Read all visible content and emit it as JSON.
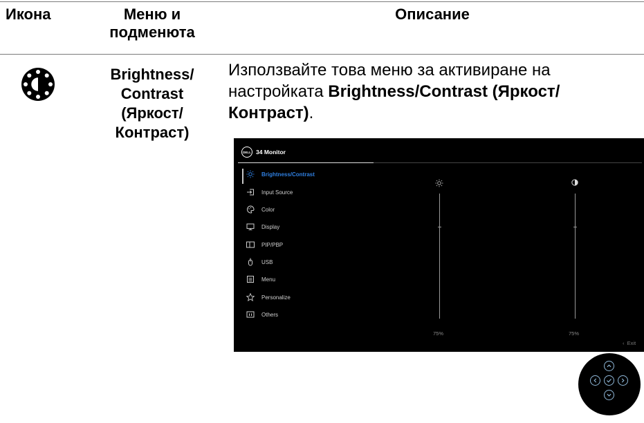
{
  "table": {
    "headers": {
      "icon": "Икона",
      "menu_line1": "Меню и",
      "menu_line2": "подменюта",
      "description": "Описание"
    },
    "row": {
      "icon": "brightness-contrast-icon",
      "menu_lines": [
        "Brightness/",
        "Contrast",
        "(Яркост/",
        "Контраст)"
      ],
      "desc_prefix": "Използвайте това меню за активиране на настройката ",
      "desc_bold": "Brightness/Contrast (Яркост/ Контраст)",
      "desc_suffix": "."
    }
  },
  "osd": {
    "logo_text": "DELL",
    "title": "34 Monitor",
    "menu_items": [
      {
        "label": "Brightness/Contrast",
        "icon": "sun-icon",
        "active": true
      },
      {
        "label": "Input Source",
        "icon": "input-source-icon",
        "active": false
      },
      {
        "label": "Color",
        "icon": "color-palette-icon",
        "active": false
      },
      {
        "label": "Display",
        "icon": "display-icon",
        "active": false
      },
      {
        "label": "PIP/PBP",
        "icon": "pip-pbp-icon",
        "active": false
      },
      {
        "label": "USB",
        "icon": "usb-icon",
        "active": false
      },
      {
        "label": "Menu",
        "icon": "menu-icon",
        "active": false
      },
      {
        "label": "Personalize",
        "icon": "star-icon",
        "active": false
      },
      {
        "label": "Others",
        "icon": "others-icon",
        "active": false
      }
    ],
    "brightness": {
      "icon": "sun-icon",
      "value_label": "75%",
      "level": 0.75
    },
    "contrast": {
      "icon": "contrast-icon",
      "value_label": "75%",
      "level": 0.75
    },
    "exit_label": "Exit"
  },
  "joystick": {
    "buttons": [
      "up",
      "left",
      "ok",
      "right",
      "down"
    ]
  }
}
